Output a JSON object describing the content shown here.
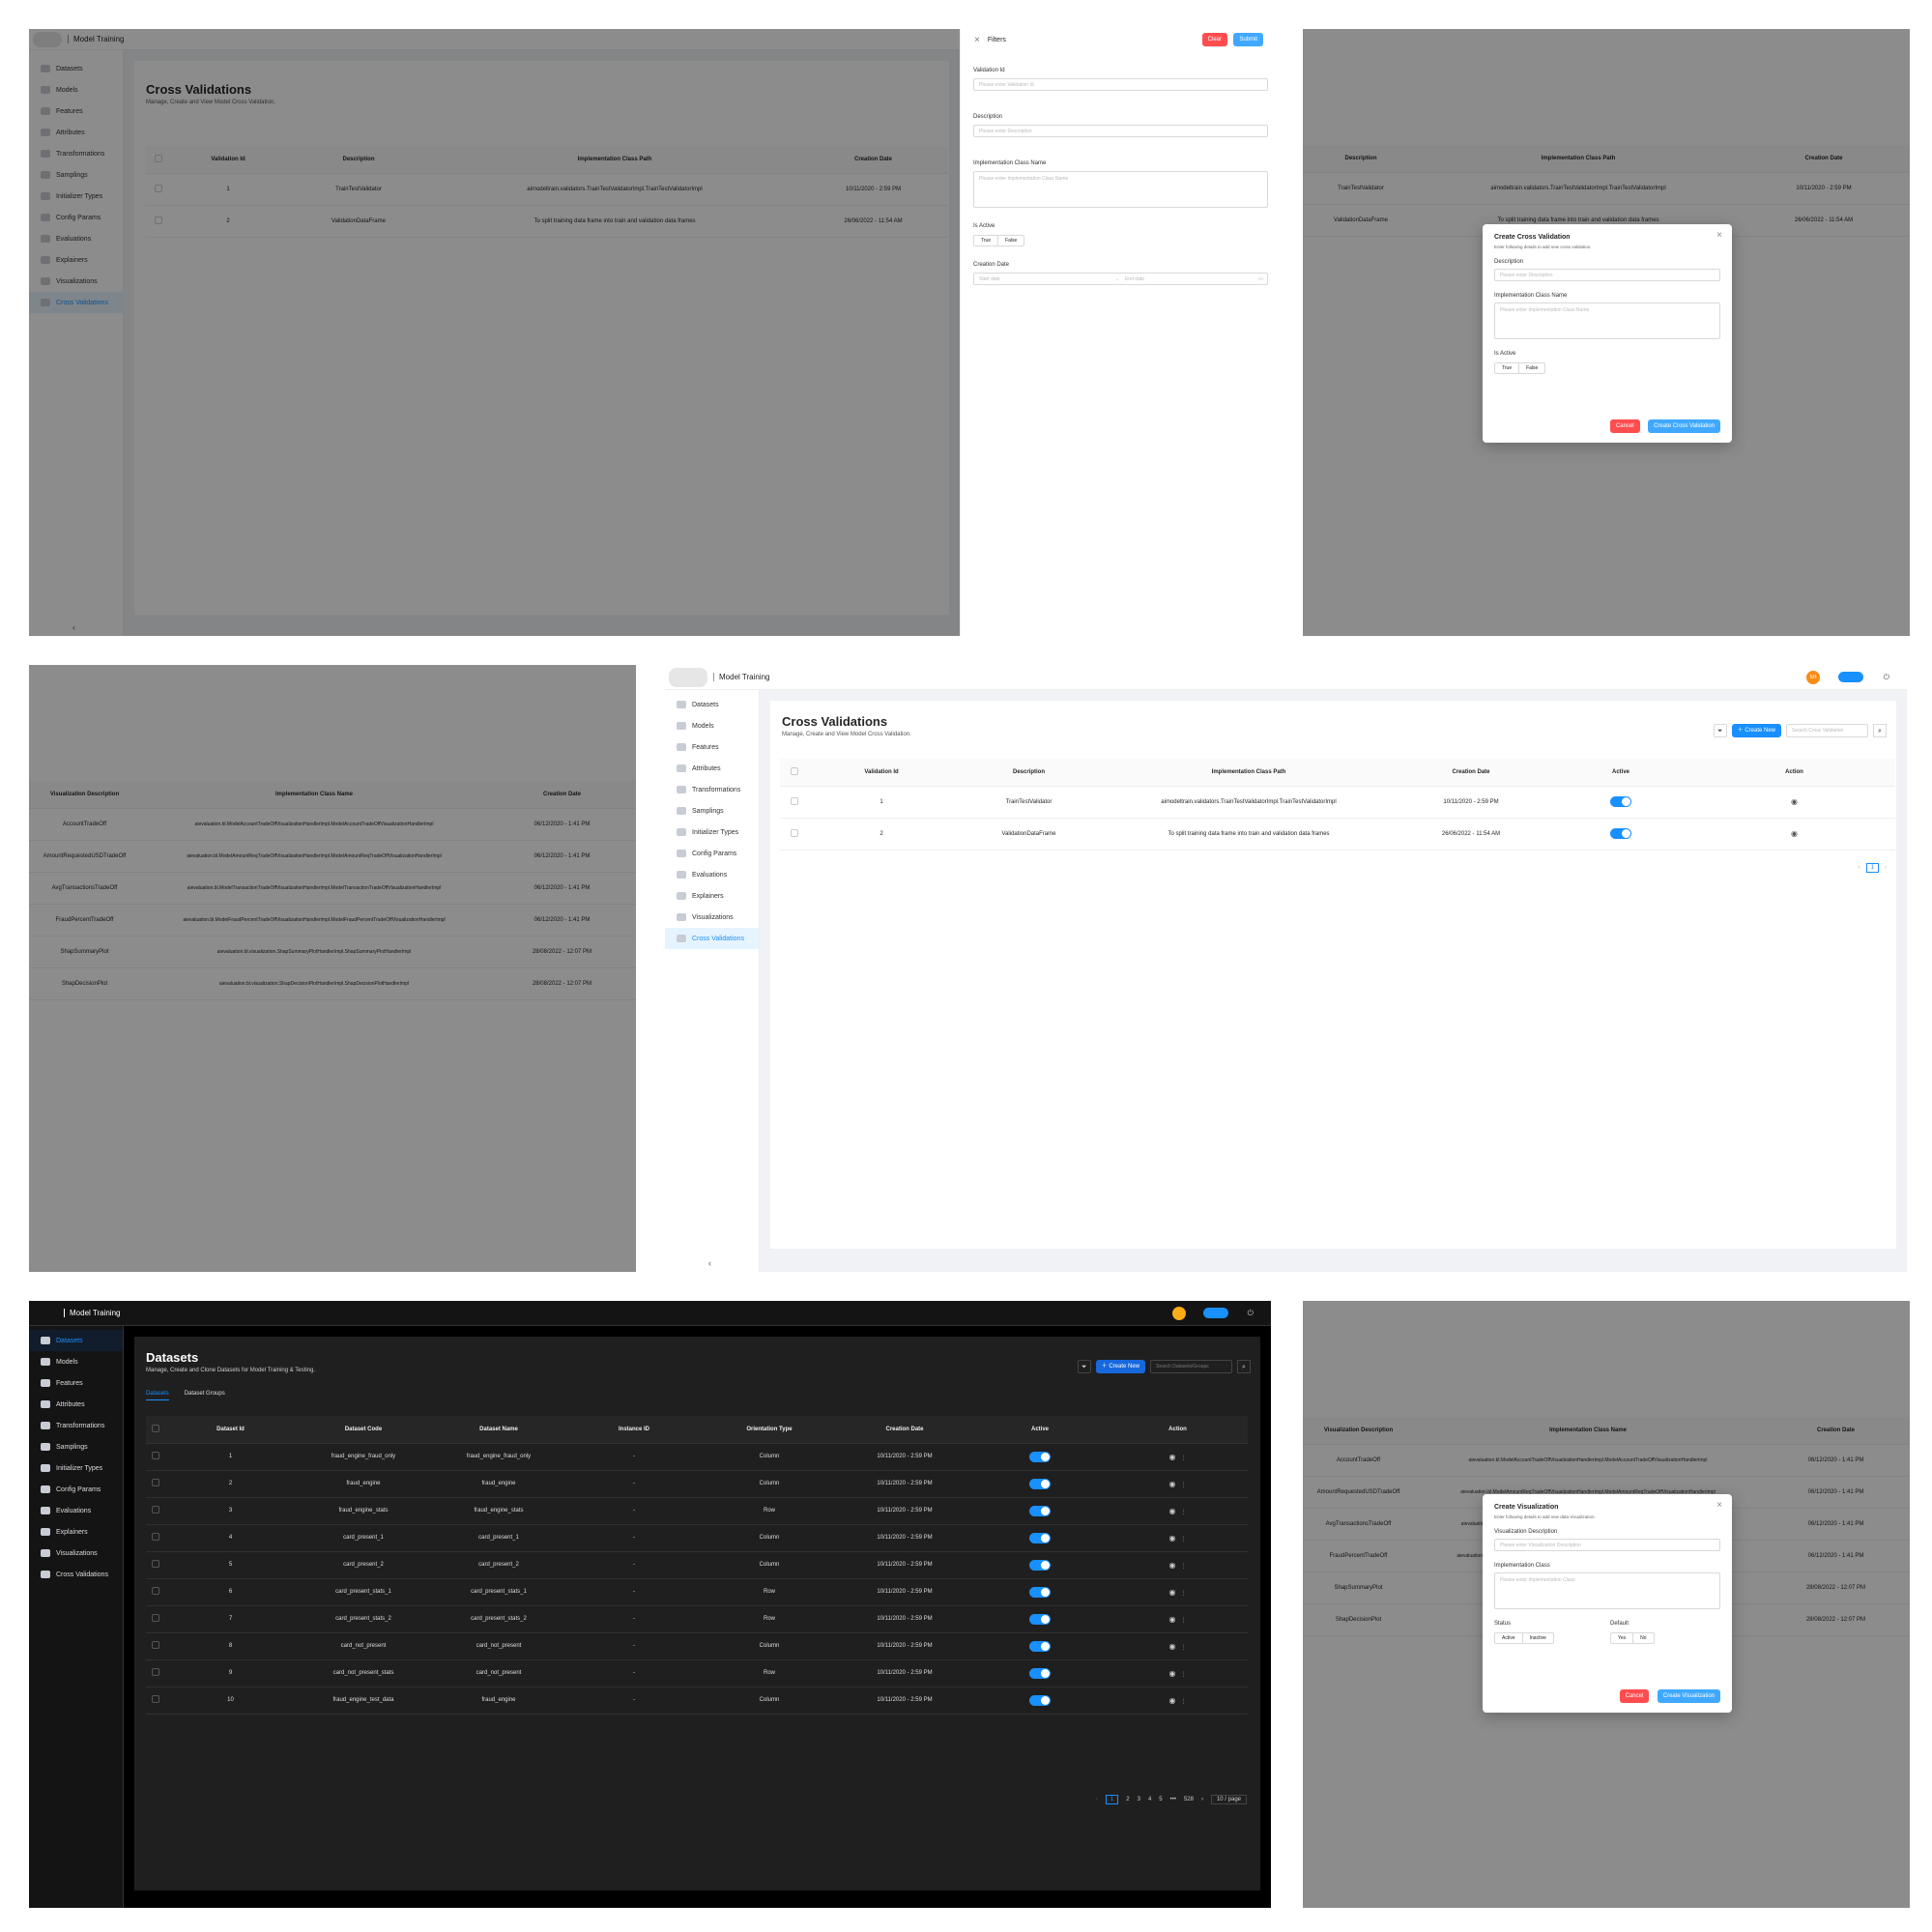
{
  "app": {
    "title": "Model Training"
  },
  "sidebar": {
    "items": [
      "Datasets",
      "Models",
      "Features",
      "Attributes",
      "Transformations",
      "Samplings",
      "Initializer Types",
      "Config Params",
      "Evaluations",
      "Explainers",
      "Visualizations",
      "Cross Validations"
    ]
  },
  "cv_page": {
    "title": "Cross Validations",
    "subtitle": "Manage, Create and View Model Cross Validation.",
    "create_new": "Create New",
    "search_placeholder": "Search Cross Validation",
    "columns": [
      "Validation Id",
      "Description",
      "Implementation Class Path",
      "Creation Date",
      "Active",
      "Action"
    ],
    "rows": [
      {
        "id": "1",
        "description": "TrainTestValidator",
        "path": "aimodeltrain.validators.TrainTestValidatorImpl.TrainTestValidatorImpl",
        "date": "10/11/2020 - 2:59 PM"
      },
      {
        "id": "2",
        "description": "ValidationDataFrame",
        "path": "To split training data frame into train and validation data frames",
        "date": "26/06/2022 - 11:54 AM"
      }
    ],
    "page": "1",
    "avatar": "SH"
  },
  "filters": {
    "title": "Filters",
    "clear": "Clear",
    "submit": "Submit",
    "validation_id_label": "Validation Id",
    "validation_id_placeholder": "Please enter Validation Id",
    "description_label": "Description",
    "description_placeholder": "Please enter Description",
    "impl_label": "Implementation Class Name",
    "impl_placeholder": "Please enter Implementation Class Name",
    "is_active_label": "Is Active",
    "true_label": "True",
    "false_label": "False",
    "creation_date_label": "Creation Date",
    "start_placeholder": "Start date",
    "end_placeholder": "End date"
  },
  "create_cv_modal": {
    "title": "Create Cross Validation",
    "subtitle": "Enter following details to add new cross validation.",
    "description_label": "Description",
    "description_placeholder": "Please enter Description",
    "impl_label": "Implementation Class Name",
    "impl_placeholder": "Please enter Implementation Class Name",
    "is_active_label": "Is Active",
    "true_label": "True",
    "false_label": "False",
    "cancel": "Cancel",
    "submit": "Create Cross Validation"
  },
  "viz_table": {
    "columns": [
      "Visualization Description",
      "Implementation Class Name",
      "Creation Date"
    ],
    "rows": [
      {
        "desc": "AccountTradeOff",
        "impl": "aievaluation.bl.ModelAccountTradeOffVisualizationHandlerImpl.ModelAccountTradeOffVisualizationHandlerImpl",
        "date": "06/12/2020 - 1:41 PM"
      },
      {
        "desc": "AmountRequestedUSDTradeOff",
        "impl": "aievaluation.bl.ModelAmountReqTradeOffVisualizationHandlerImpl.ModelAmountReqTradeOffVisualizationHandlerImpl",
        "date": "06/12/2020 - 1:41 PM"
      },
      {
        "desc": "AvgTransactionsTradeOff",
        "impl": "aievaluation.bl.ModelTransactionTradeOffVisualizationHandlerImpl.ModelTransactionTradeOffVisualizationHandlerImpl",
        "date": "06/12/2020 - 1:41 PM"
      },
      {
        "desc": "FraudPercentTradeOff",
        "impl": "aievaluation.bl.ModelFraudPercentTradeOffVisualizationHandlerImpl.ModelFraudPercentTradeOffVisualizationHandlerImpl",
        "date": "06/12/2020 - 1:41 PM"
      },
      {
        "desc": "ShapSummaryPlot",
        "impl": "aievaluation.bl.visualization.ShapSummaryPlotHandlerImpl.ShapSummaryPlotHandlerImpl",
        "date": "28/08/2022 - 12:07 PM"
      },
      {
        "desc": "ShapDecisionPlot",
        "impl": "aievaluation.bl.visualization.ShapDecisionPlotHandlerImpl.ShapDecisionPlotHandlerImpl",
        "date": "28/08/2022 - 12:07 PM"
      }
    ]
  },
  "create_viz_modal": {
    "title": "Create Visualization",
    "subtitle": "Enter following details to add new data Visualization.",
    "desc_label": "Visualization Description",
    "desc_placeholder": "Please enter Visualization Description",
    "impl_label": "Implementation Class",
    "impl_placeholder": "Please enter Implementation Class",
    "status_label": "Status",
    "active": "Active",
    "inactive": "Inactive",
    "default_label": "Default",
    "yes": "Yes",
    "no": "No",
    "cancel": "Cancel",
    "submit": "Create Visualization"
  },
  "datasets_page": {
    "title": "Datasets",
    "subtitle": "Manage, Create and Clone Datasets for Model Training & Testing.",
    "create_new": "Create New",
    "search_placeholder": "Search Datasets/Groups",
    "tabs": [
      "Datasets",
      "Dataset Groups"
    ],
    "columns": [
      "Dataset Id",
      "Dataset Code",
      "Dataset Name",
      "Instance ID",
      "Orientation Type",
      "Creation Date",
      "Active",
      "Action"
    ],
    "rows": [
      {
        "id": "1",
        "code": "fraud_engine_fraud_only",
        "name": "fraud_engine_fraud_only",
        "instance": "-",
        "orient": "Column",
        "date": "10/11/2020 - 2:59 PM"
      },
      {
        "id": "2",
        "code": "fraud_engine",
        "name": "fraud_engine",
        "instance": "-",
        "orient": "Column",
        "date": "10/11/2020 - 2:59 PM"
      },
      {
        "id": "3",
        "code": "fraud_engine_stats",
        "name": "fraud_engine_stats",
        "instance": "-",
        "orient": "Row",
        "date": "10/11/2020 - 2:59 PM"
      },
      {
        "id": "4",
        "code": "card_present_1",
        "name": "card_present_1",
        "instance": "-",
        "orient": "Column",
        "date": "10/11/2020 - 2:59 PM"
      },
      {
        "id": "5",
        "code": "card_present_2",
        "name": "card_present_2",
        "instance": "-",
        "orient": "Column",
        "date": "10/11/2020 - 2:59 PM"
      },
      {
        "id": "6",
        "code": "card_present_stats_1",
        "name": "card_present_stats_1",
        "instance": "-",
        "orient": "Row",
        "date": "10/11/2020 - 2:59 PM"
      },
      {
        "id": "7",
        "code": "card_present_stats_2",
        "name": "card_present_stats_2",
        "instance": "-",
        "orient": "Row",
        "date": "10/11/2020 - 2:59 PM"
      },
      {
        "id": "8",
        "code": "card_not_present",
        "name": "card_not_present",
        "instance": "-",
        "orient": "Column",
        "date": "10/11/2020 - 2:59 PM"
      },
      {
        "id": "9",
        "code": "card_not_present_stats",
        "name": "card_not_present",
        "instance": "-",
        "orient": "Row",
        "date": "10/11/2020 - 2:59 PM"
      },
      {
        "id": "10",
        "code": "fraud_engine_test_data",
        "name": "fraud_engine",
        "instance": "-",
        "orient": "Column",
        "date": "10/11/2020 - 2:59 PM"
      }
    ],
    "pagination": [
      "1",
      "2",
      "3",
      "4",
      "5",
      "•••",
      "528"
    ],
    "page_size": "10 / page"
  }
}
